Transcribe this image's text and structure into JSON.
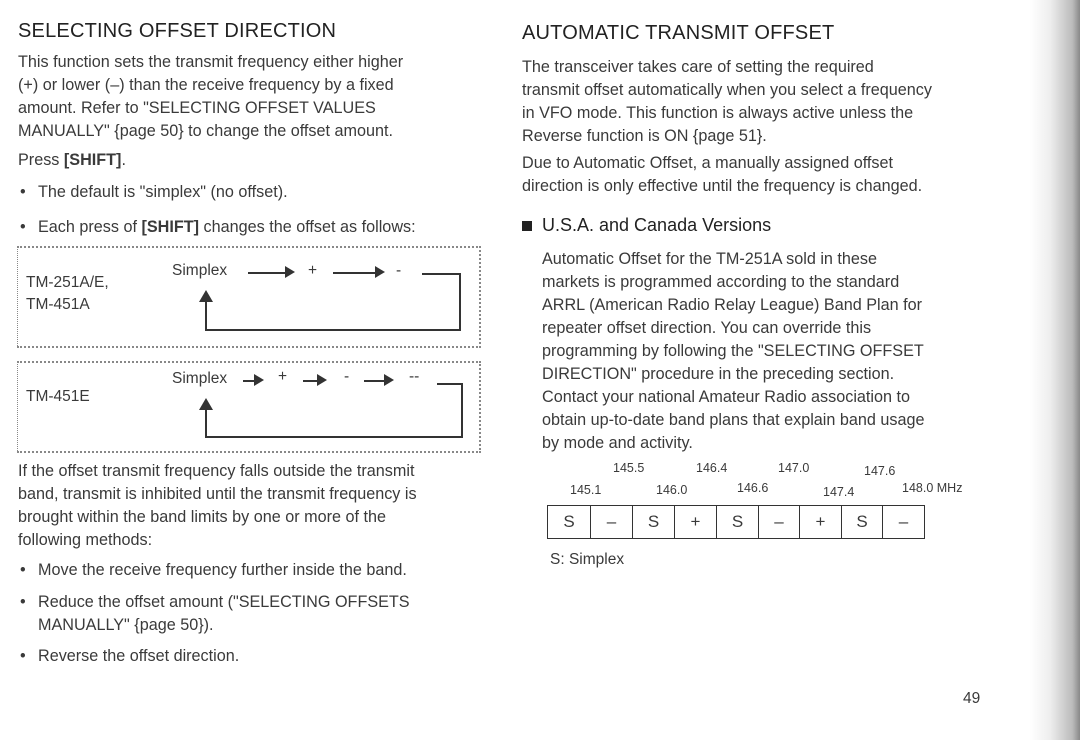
{
  "left": {
    "title": "SELECTING OFFSET DIRECTION",
    "intro": [
      "This function sets the transmit frequency either higher",
      "(+) or lower (–) than the receive frequency by a fixed",
      "amount.  Refer to \"SELECTING OFFSET VALUES",
      "MANUALLY\" {page 50} to change the offset amount."
    ],
    "press_prefix": "Press ",
    "press_key": "[SHIFT]",
    "press_suffix": ".",
    "bullet1": "The default is \"simplex\" (no offset).",
    "bullet2_prefix": "Each press of ",
    "bullet2_key": "[SHIFT]",
    "bullet2_suffix": " changes the offset as follows:",
    "diagram1": {
      "models": [
        "TM-251A/E,",
        "TM-451A"
      ],
      "sequence": [
        "Simplex",
        "+",
        "-"
      ]
    },
    "diagram2": {
      "models": [
        "TM-451E"
      ],
      "sequence": [
        "Simplex",
        "+",
        "-",
        "--"
      ]
    },
    "para2": [
      "If the offset transmit frequency falls outside the transmit",
      "band, transmit is inhibited until the transmit frequency is",
      "brought within the band limits by one or more of the",
      "following methods:"
    ],
    "bullets": [
      "Move the receive frequency further inside the band.",
      "Reduce the offset amount (\"SELECTING OFFSETS",
      "MANUALLY\" {page 50}).",
      "Reverse the offset direction."
    ]
  },
  "right": {
    "title": "AUTOMATIC TRANSMIT OFFSET",
    "para1": [
      "The transceiver takes care of setting the required",
      "transmit offset automatically when you select a frequency",
      "in VFO mode.  This function is always active unless the",
      "Reverse function is ON {page 51}."
    ],
    "para2": [
      "Due to Automatic Offset, a manually assigned offset",
      "direction is only effective until the frequency is changed."
    ],
    "subtitle": "U.S.A. and Canada Versions",
    "para3": [
      "Automatic Offset for the TM-251A sold in these",
      "markets is programmed according to the standard",
      "ARRL (American Radio Relay League) Band Plan for",
      "repeater offset direction.  You can override this",
      "programming by following the \"SELECTING OFFSET",
      "DIRECTION\" procedure in the preceding section.",
      "Contact your national Amateur Radio association to",
      "obtain up-to-date band plans that explain band usage",
      "by mode and activity."
    ],
    "band_top": [
      "145.5",
      "146.4",
      "147.0",
      "147.6"
    ],
    "band_bottom": [
      "145.1",
      "146.0",
      "146.6",
      "147.4",
      "148.0 MHz"
    ],
    "cells": [
      "S",
      "–",
      "S",
      "+",
      "S",
      "–",
      "+",
      "S",
      "–"
    ],
    "legend": "S:  Simplex"
  },
  "page_number": "49"
}
